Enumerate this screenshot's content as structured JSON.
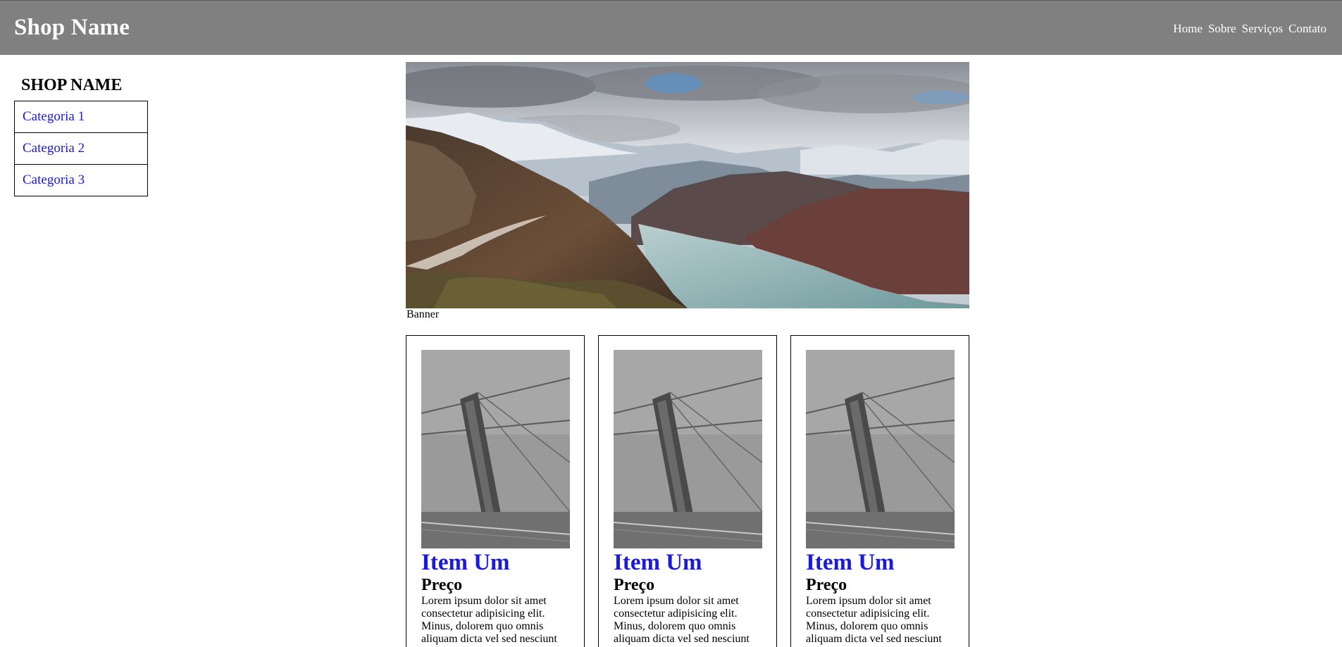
{
  "header": {
    "brand": "Shop Name",
    "nav": [
      "Home",
      "Sobre",
      "Serviços",
      "Contato"
    ]
  },
  "sidebar": {
    "title": "SHOP NAME",
    "categories": [
      "Categoria 1",
      "Categoria 2",
      "Categoria 3"
    ]
  },
  "banner": {
    "caption": "Banner",
    "image": "mountain-lake-landscape"
  },
  "products": [
    {
      "title": "Item Um",
      "price_label": "Preço",
      "description": "Lorem ipsum dolor sit amet consectetur adipisicing elit. Minus, dolorem quo omnis aliquam dicta vel sed nesciunt",
      "image": "bridge-tower-over-water"
    },
    {
      "title": "Item Um",
      "price_label": "Preço",
      "description": "Lorem ipsum dolor sit amet consectetur adipisicing elit. Minus, dolorem quo omnis aliquam dicta vel sed nesciunt",
      "image": "bridge-tower-over-water"
    },
    {
      "title": "Item Um",
      "price_label": "Preço",
      "description": "Lorem ipsum dolor sit amet consectetur adipisicing elit. Minus, dolorem quo omnis aliquam dicta vel sed nesciunt",
      "image": "bridge-tower-over-water"
    }
  ],
  "colors": {
    "header_bg": "#808080",
    "link": "#1a1adc",
    "text": "#000000",
    "page_bg": "#ffffff"
  }
}
